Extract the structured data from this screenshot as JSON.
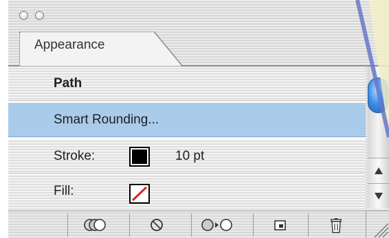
{
  "panel": {
    "tab_label": "Appearance",
    "rows": [
      {
        "label": "Path"
      },
      {
        "label": "Smart Rounding..."
      },
      {
        "label": "Stroke:",
        "value": "10 pt"
      },
      {
        "label": "Fill:"
      }
    ]
  },
  "colors": {
    "selection": "#aacbea",
    "stroke_swatch": "#000000",
    "fill_none_slash": "#e02020",
    "scroll_thumb": "#3d8ee6"
  },
  "icons": {
    "titlebar": [
      "close-button",
      "zoom-button"
    ],
    "toolbar": [
      "new-art-basic-appearance-icon",
      "clear-appearance-icon",
      "reduce-to-basic-appearance-icon",
      "duplicate-item-icon",
      "delete-item-icon"
    ]
  }
}
